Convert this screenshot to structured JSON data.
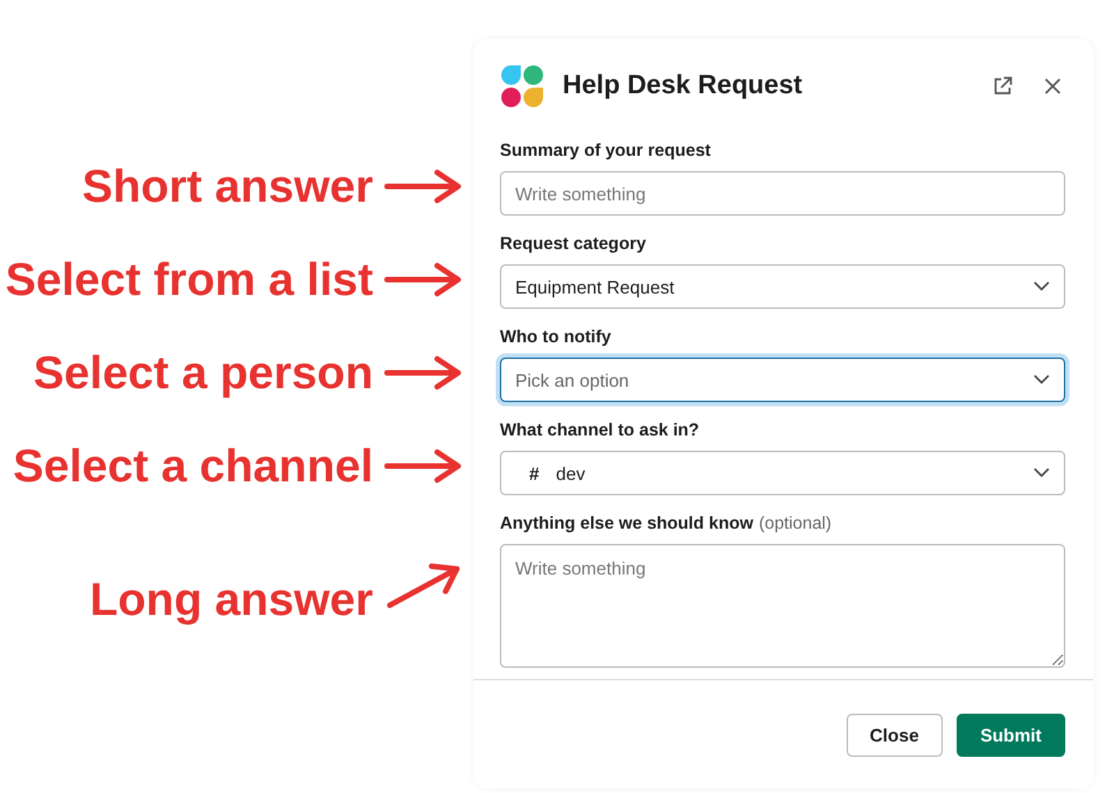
{
  "dialog": {
    "title": "Help Desk Request"
  },
  "fields": [
    {
      "kind": "text",
      "label": "Summary of your request",
      "placeholder": "Write something",
      "annotation": "Short answer"
    },
    {
      "kind": "select",
      "label": "Request category",
      "value": "Equipment Request",
      "focused": false,
      "annotation": "Select from a list"
    },
    {
      "kind": "select",
      "label": "Who to notify",
      "placeholder": "Pick an option",
      "focused": true,
      "annotation": "Select a person"
    },
    {
      "kind": "channel",
      "label": "What channel to ask in?",
      "prefix": "#",
      "value": "dev",
      "annotation": "Select a channel"
    },
    {
      "kind": "textarea",
      "label": "Anything else we should know",
      "hint": "(optional)",
      "placeholder": "Write something",
      "annotation": "Long answer"
    }
  ],
  "buttons": [
    {
      "kind": "secondary",
      "label": "Close"
    },
    {
      "kind": "primary",
      "label": "Submit"
    }
  ]
}
